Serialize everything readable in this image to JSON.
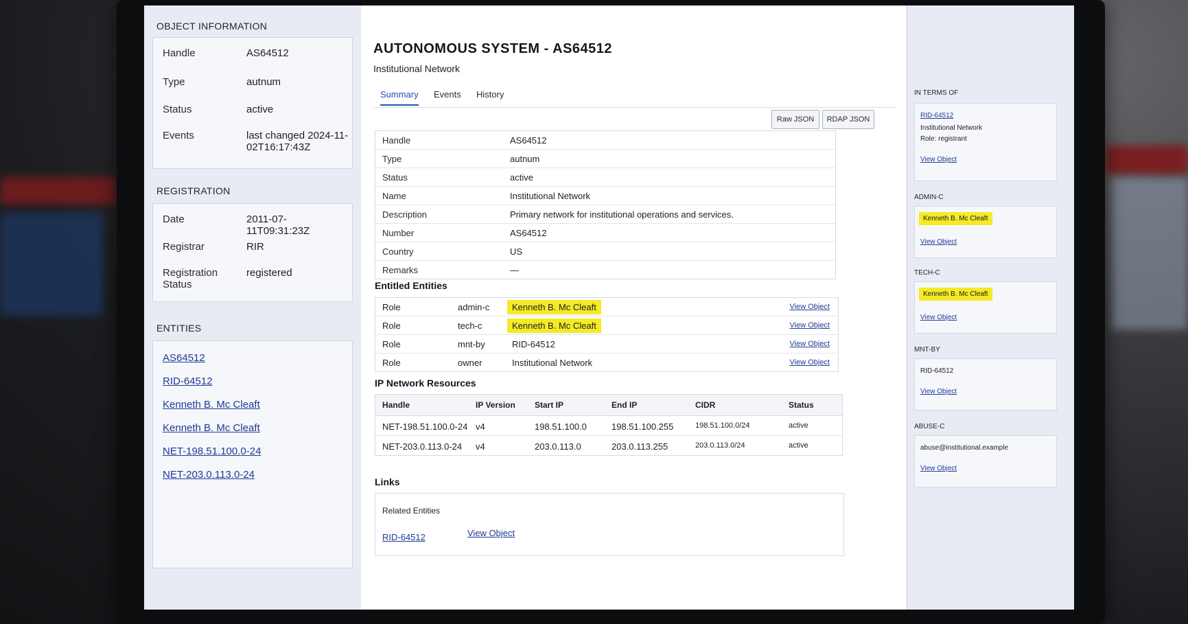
{
  "left": {
    "object_info_title": "OBJECT INFORMATION",
    "object_info": [
      {
        "key": "Handle",
        "value": "AS64512"
      },
      {
        "key": "Type",
        "value": "autnum"
      },
      {
        "key": "Status",
        "value": "active"
      },
      {
        "key": "Events",
        "value": "last changed 2024-11-02T16:17:43Z"
      }
    ],
    "registration_title": "REGISTRATION",
    "registration": [
      {
        "key": "Date",
        "value": "2011-07-11T09:31:23Z"
      },
      {
        "key": "Registrar",
        "value": "RIR"
      },
      {
        "key": "Registration Status",
        "value": "registered"
      }
    ],
    "entities_title": "ENTITIES",
    "entities": [
      "AS64512",
      "RID-64512",
      "Kenneth B. Mc Cleaft",
      "Kenneth B. Mc Cleaft",
      "NET-198.51.100.0-24",
      "NET-203.0.113.0-24"
    ]
  },
  "main": {
    "title": "AUTONOMOUS SYSTEM - AS64512",
    "subtitle": "Institutional Network",
    "tabs": [
      "Summary",
      "Events",
      "History"
    ],
    "buttons": {
      "raw_json": "Raw JSON",
      "rdap_json": "RDAP JSON"
    },
    "summary": [
      {
        "key": "Handle",
        "value": "AS64512"
      },
      {
        "key": "Type",
        "value": "autnum"
      },
      {
        "key": "Status",
        "value": "active"
      },
      {
        "key": "Name",
        "value": "Institutional Network"
      },
      {
        "key": "Description",
        "value": "Primary network for institutional operations and services."
      },
      {
        "key": "Number",
        "value": "AS64512"
      },
      {
        "key": "Country",
        "value": "US"
      },
      {
        "key": "Remarks",
        "value": "—"
      }
    ],
    "entitled_title": "Entitled Entities",
    "entitled": [
      {
        "label": "Role",
        "role": "admin-c",
        "name": "Kenneth B. Mc Cleaft",
        "action": "View Object"
      },
      {
        "label": "Role",
        "role": "tech-c",
        "name": "Kenneth B. Mc Cleaft",
        "action": "View Object"
      },
      {
        "label": "Role",
        "role": "mnt-by",
        "name": "RID-64512",
        "action": "View Object"
      },
      {
        "label": "Role",
        "role": "owner",
        "name": "Institutional Network",
        "action": "View Object"
      }
    ],
    "ip_title": "IP Network Resources",
    "ip_headers": [
      "Handle",
      "IP Version",
      "Start IP",
      "End IP",
      "CIDR",
      "Status"
    ],
    "ip_rows": [
      [
        "NET-198.51.100.0-24",
        "v4",
        "198.51.100.0",
        "198.51.100.255",
        "198.51.100.0/24",
        "active"
      ],
      [
        "NET-203.0.113.0-24",
        "v4",
        "203.0.113.0",
        "203.0.113.255",
        "203.0.113.0/24",
        "active"
      ]
    ],
    "links_title": "Links",
    "links_sub": "Related Entities",
    "links_entity": "RID-64512",
    "links_action": "View Object"
  },
  "right": {
    "in_terms_title": "IN TERMS OF",
    "in_terms_link": "RID-64512",
    "in_terms_name": "Institutional Network",
    "in_terms_role": "Role: registrant",
    "view_object": "View Object",
    "admin_title": "ADMIN-C",
    "admin_name": "Kenneth B. Mc Cleaft",
    "tech_title": "TECH-C",
    "tech_name": "Kenneth B. Mc Cleaft",
    "mnt_title": "MNT-BY",
    "mnt_value": "RID-64512",
    "abuse_title": "ABUSE-C",
    "abuse_value": "abuse@institutional.example"
  }
}
